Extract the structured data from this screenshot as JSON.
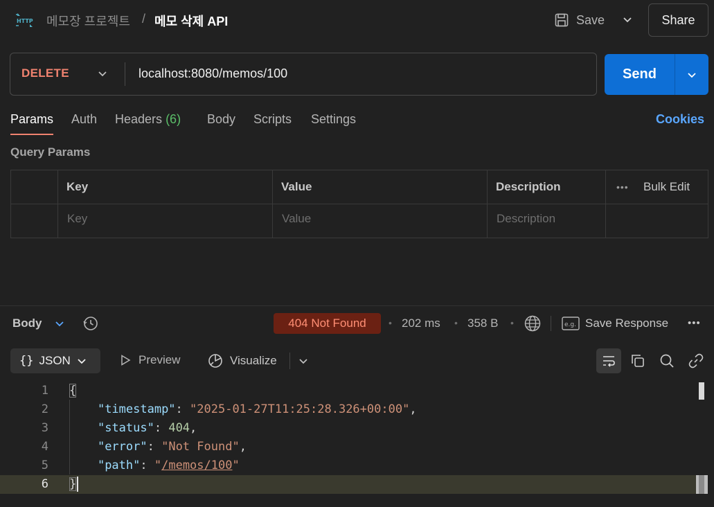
{
  "header": {
    "icon": "http-icon",
    "breadcrumb_parent": "메모장 프로젝트",
    "separator": "/",
    "title": "메모 삭제 API",
    "save_label": "Save",
    "share_label": "Share"
  },
  "request": {
    "method": "DELETE",
    "url": "localhost:8080/memos/100",
    "send_label": "Send"
  },
  "tabs": [
    {
      "label": "Params",
      "active": true
    },
    {
      "label": "Auth"
    },
    {
      "label": "Headers",
      "count": "(6)"
    },
    {
      "label": "Body"
    },
    {
      "label": "Scripts"
    },
    {
      "label": "Settings"
    }
  ],
  "cookies_label": "Cookies",
  "query_params": {
    "title": "Query Params",
    "headers": [
      "Key",
      "Value",
      "Description"
    ],
    "bulk_edit": "Bulk Edit",
    "placeholders": [
      "Key",
      "Value",
      "Description"
    ]
  },
  "response": {
    "body_label": "Body",
    "status": "404 Not Found",
    "time": "202 ms",
    "size": "358 B",
    "save_response": "Save Response",
    "format": "JSON",
    "preview_label": "Preview",
    "visualize_label": "Visualize",
    "colors": {
      "status_bg": "#6b2113",
      "status_text": "#ff8e74",
      "accent": "#0e6fd6"
    },
    "code_lines": [
      {
        "num": "1",
        "open": "{"
      },
      {
        "num": "2",
        "key": "\"timestamp\"",
        "sep": ": ",
        "value": "\"2025-01-27T11:25:28.326+00:00\"",
        "tail": ","
      },
      {
        "num": "3",
        "key": "\"status\"",
        "sep": ": ",
        "value": "404",
        "tail": ","
      },
      {
        "num": "4",
        "key": "\"error\"",
        "sep": ": ",
        "value": "\"Not Found\"",
        "tail": ","
      },
      {
        "num": "5",
        "key": "\"path\"",
        "sep": ": ",
        "q1": "\"",
        "value": "/memos/100",
        "q2": "\""
      },
      {
        "num": "6",
        "close": "}"
      }
    ]
  }
}
